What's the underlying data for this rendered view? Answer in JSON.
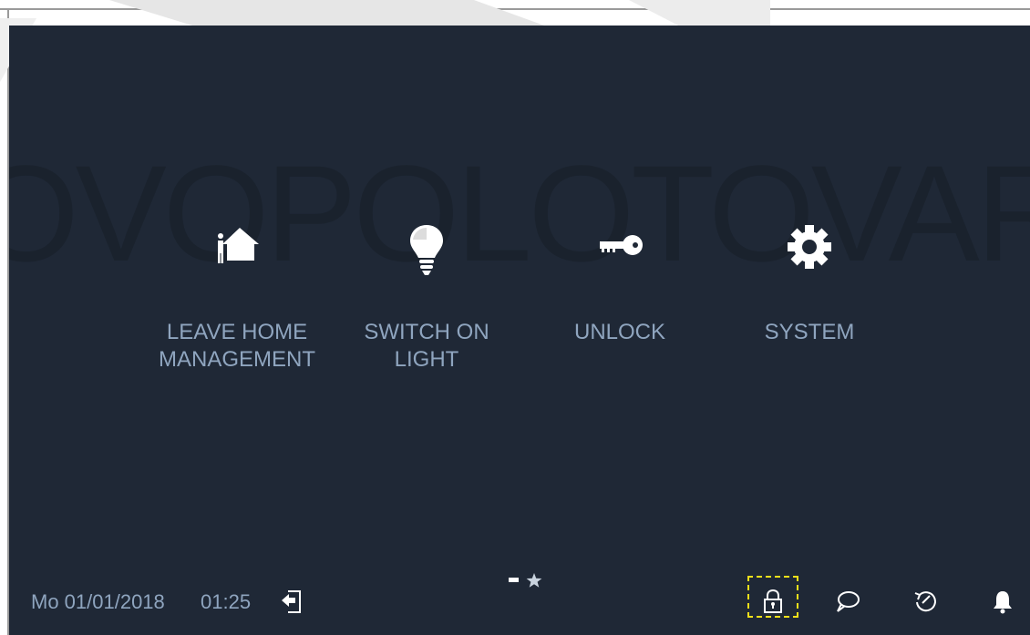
{
  "watermark": {
    "text": "OVOPOLOTOVAR"
  },
  "colors": {
    "background": "#1f2836",
    "label": "#8fa5bf",
    "icon": "#ffffff",
    "highlight": "#f0e01a"
  },
  "tiles": [
    {
      "line1": "LEAVE HOME",
      "line2": "MANAGEMENT",
      "icon": "leave-home-icon"
    },
    {
      "line1": "SWITCH ON",
      "line2": "LIGHT",
      "icon": "light-bulb-icon"
    },
    {
      "line1": "UNLOCK",
      "line2": "",
      "icon": "key-icon"
    },
    {
      "line1": "SYSTEM",
      "line2": "",
      "icon": "gear-icon"
    }
  ],
  "status_bar": {
    "date": "Mo 01/01/2018",
    "time": "01:25",
    "icons": [
      "exit-icon",
      "lock-icon",
      "message-icon",
      "history-icon",
      "bell-icon"
    ]
  },
  "page_indicator": {
    "pages": 2,
    "current": 1
  }
}
